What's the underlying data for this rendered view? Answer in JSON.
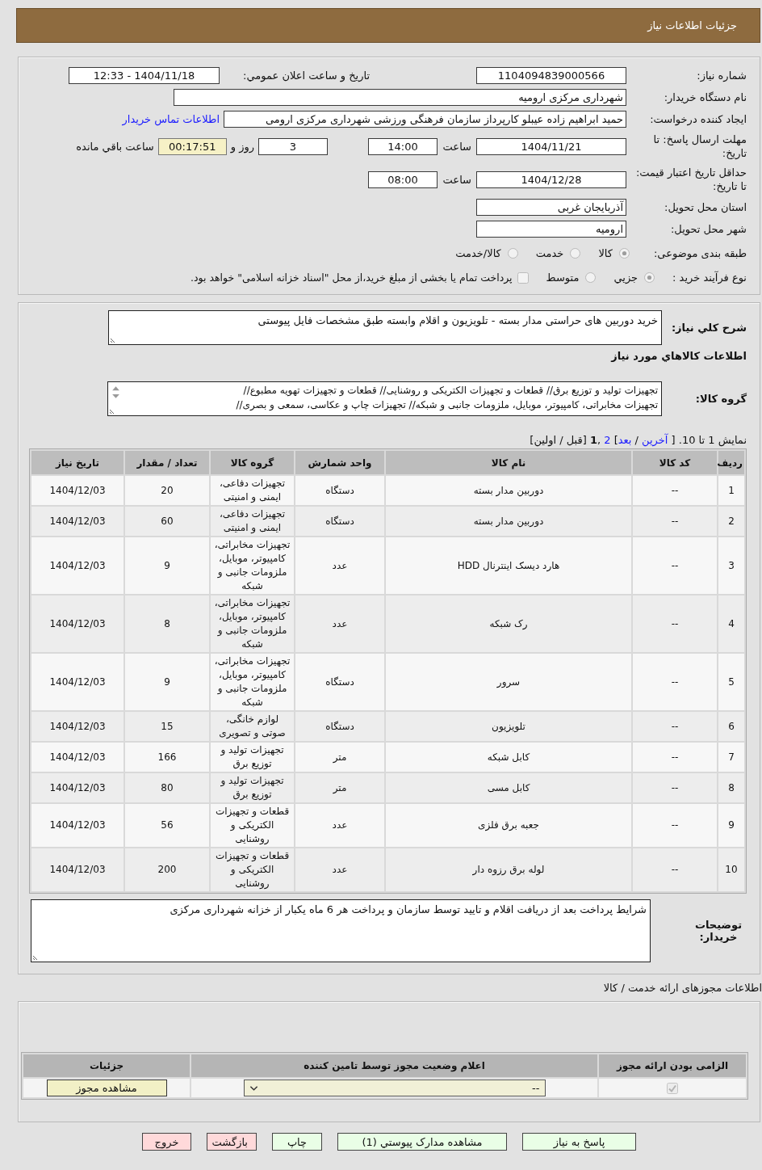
{
  "header": {
    "title": "جزئيات اطلاعات نياز"
  },
  "details": {
    "need_number": {
      "label": "شماره نياز:",
      "value": "1104094839000566"
    },
    "announcement": {
      "label": "تاريخ و ساعت اعلان عمومي:",
      "value": "1404/11/18 - 12:33"
    },
    "buyer_org": {
      "label": "نام دستگاه خريدار:",
      "value": "شهرداری مرکزی ارومیه"
    },
    "requester": {
      "label": "ايجاد کننده درخواست:",
      "value": "حميد ابراهيم زاده عيبلو كارپرداز سازمان فرهنگی ورزشی شهرداری مرکزی ارومی",
      "contact_link": "اطلاعات تماس خريدار"
    },
    "reply_deadline": {
      "label": "مهلت ارسال پاسخ: تا تاريخ:",
      "date": "1404/11/21",
      "time_label": "ساعت",
      "time": "14:00",
      "days": "3",
      "days_label": "روز و",
      "remaining": "00:17:51",
      "remaining_label": "ساعت باقي مانده"
    },
    "price_validity": {
      "label": "حداقل تاريخ اعتبار قيمت: تا تاريخ:",
      "date": "1404/12/28",
      "time_label": "ساعت",
      "time": "08:00"
    },
    "province": {
      "label": "استان محل تحويل:",
      "value": "آذربايجان غربی"
    },
    "city": {
      "label": "شهر محل تحويل:",
      "value": "اروميه"
    },
    "category": {
      "label": "طبقه بندی موضوعی:",
      "options": [
        {
          "label": "کالا",
          "selected": true
        },
        {
          "label": "خدمت",
          "selected": false
        },
        {
          "label": "کالا/خدمت",
          "selected": false
        }
      ]
    },
    "purchase_process": {
      "label": "نوع فرآيند خريد :",
      "options": [
        {
          "label": "جزيي",
          "selected": true
        },
        {
          "label": "متوسط",
          "selected": false
        }
      ],
      "treasury_option": {
        "label": "پرداخت تمام يا بخشی از مبلغ خريد،از محل \"اسناد خزانه اسلامی\" خواهد بود.",
        "checked": false
      }
    }
  },
  "need": {
    "description": {
      "label": "شرح كلي نياز:",
      "value": "خريد دوربين های حراستی مدار بسته - تلويزيون و اقلام وابسته طبق مشخصات فايل پيوستی"
    },
    "goods_heading": "اطلاعات كالاهاي مورد نياز",
    "goods_group": {
      "label": "گروه كالا:",
      "lines": [
        "تجهيزات توليد و توزيع برق// قطعات و تجهيزات الكتريكی و روشنايی// قطعات و تجهيزات تهويه مطبوع//",
        "تجهيزات مخابراتی، كامپيوتر، موبايل، ملزومات جانبی و شبكه// تجهيزات چاپ و عكاسی، سمعی و بصری//"
      ]
    },
    "pagination": {
      "parts": [
        {
          "kind": "text",
          "text": "نمايش 1 تا 10. [ "
        },
        {
          "kind": "link",
          "text": "آخرين"
        },
        {
          "kind": "text",
          "text": " / "
        },
        {
          "kind": "link",
          "text": "بعد"
        },
        {
          "kind": "text",
          "text": "] "
        },
        {
          "kind": "link",
          "text": "2"
        },
        {
          "kind": "text",
          "text": " ,"
        },
        {
          "kind": "current",
          "text": "1"
        },
        {
          "kind": "text",
          "text": " [قبل / اولين]"
        }
      ]
    },
    "table": {
      "columns": [
        "رديف",
        "كد كالا",
        "نام كالا",
        "واحد شمارش",
        "گروه كالا",
        "تعداد / مقدار",
        "تاريخ نياز"
      ],
      "rows": [
        [
          "1",
          "--",
          "دوربين مدار بسته",
          "دستگاه",
          "تجهيزات دفاعی، ايمنی و امنيتی",
          "20",
          "1404/12/03"
        ],
        [
          "2",
          "--",
          "دوربين مدار بسته",
          "دستگاه",
          "تجهيزات دفاعی، ايمنی و امنيتی",
          "60",
          "1404/12/03"
        ],
        [
          "3",
          "--",
          "هارد ديسک اينترنال HDD",
          "عدد",
          "تجهيزات مخابراتی، كامپيوتر، موبايل، ملزومات جانبی و شبكه",
          "9",
          "1404/12/03"
        ],
        [
          "4",
          "--",
          "رک شبكه",
          "عدد",
          "تجهيزات مخابراتی، كامپيوتر، موبايل، ملزومات جانبی و شبكه",
          "8",
          "1404/12/03"
        ],
        [
          "5",
          "--",
          "سرور",
          "دستگاه",
          "تجهيزات مخابراتی، كامپيوتر، موبايل، ملزومات جانبی و شبكه",
          "9",
          "1404/12/03"
        ],
        [
          "6",
          "--",
          "تلويزيون",
          "دستگاه",
          "لوازم خانگی، صوتی و تصويری",
          "15",
          "1404/12/03"
        ],
        [
          "7",
          "--",
          "كابل شبكه",
          "متر",
          "تجهيزات توليد و توزيع برق",
          "166",
          "1404/12/03"
        ],
        [
          "8",
          "--",
          "كابل مسی",
          "متر",
          "تجهيزات توليد و توزيع برق",
          "80",
          "1404/12/03"
        ],
        [
          "9",
          "--",
          "جعبه برق فلزی",
          "عدد",
          "قطعات و تجهيزات الكتريكی و روشنايی",
          "56",
          "1404/12/03"
        ],
        [
          "10",
          "--",
          "لوله برق رزوه دار",
          "عدد",
          "قطعات و تجهيزات الكتريكی و روشنايی",
          "200",
          "1404/12/03"
        ]
      ]
    },
    "buyer_notes": {
      "label": "توضيحات خريدار:",
      "value": "شرايط پرداخت بعد از دريافت اقلام و تاييد توسط سازمان و پرداخت هر 6 ماه يكبار از خزانه شهرداری مركزی"
    }
  },
  "licenses": {
    "heading": "اطلاعات مجوزهای ارائه خدمت / كالا",
    "columns": [
      "الزامی بودن ارائه مجوز",
      "اعلام وضعيت مجوز توسط تامين كننده",
      "جزئيات"
    ],
    "rows": [
      {
        "required": true,
        "status": "--",
        "details_button": "مشاهده مجوز"
      }
    ]
  },
  "actions": [
    {
      "label": "پاسخ به نياز",
      "kind": "confirm"
    },
    {
      "label": "مشاهده مدارک پيوستي (1)",
      "kind": "confirm"
    },
    {
      "label": "چاپ",
      "kind": "confirm"
    },
    {
      "label": "بازگشت",
      "kind": "cancel"
    },
    {
      "label": "خروج",
      "kind": "cancel"
    }
  ]
}
